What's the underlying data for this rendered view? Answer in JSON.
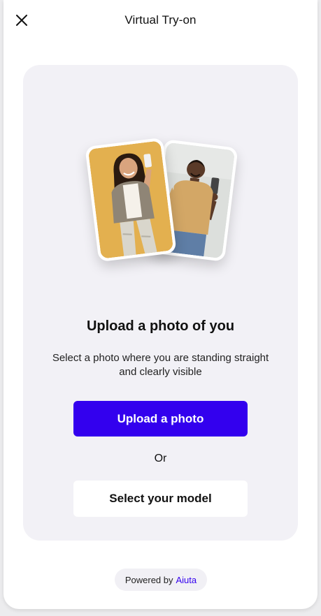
{
  "header": {
    "title": "Virtual Try-on",
    "close_icon": "close-icon"
  },
  "main": {
    "heading": "Upload a photo of you",
    "description": "Select a photo where you are standing straight and clearly visible",
    "primary_button_label": "Upload a photo",
    "or_label": "Or",
    "secondary_button_label": "Select your model"
  },
  "footer": {
    "powered_by_prefix": "Powered by",
    "brand_name": "Aiuta"
  },
  "colors": {
    "accent": "#3300ee",
    "card_background": "#f2f1f6",
    "page_background": "#ffffff"
  }
}
